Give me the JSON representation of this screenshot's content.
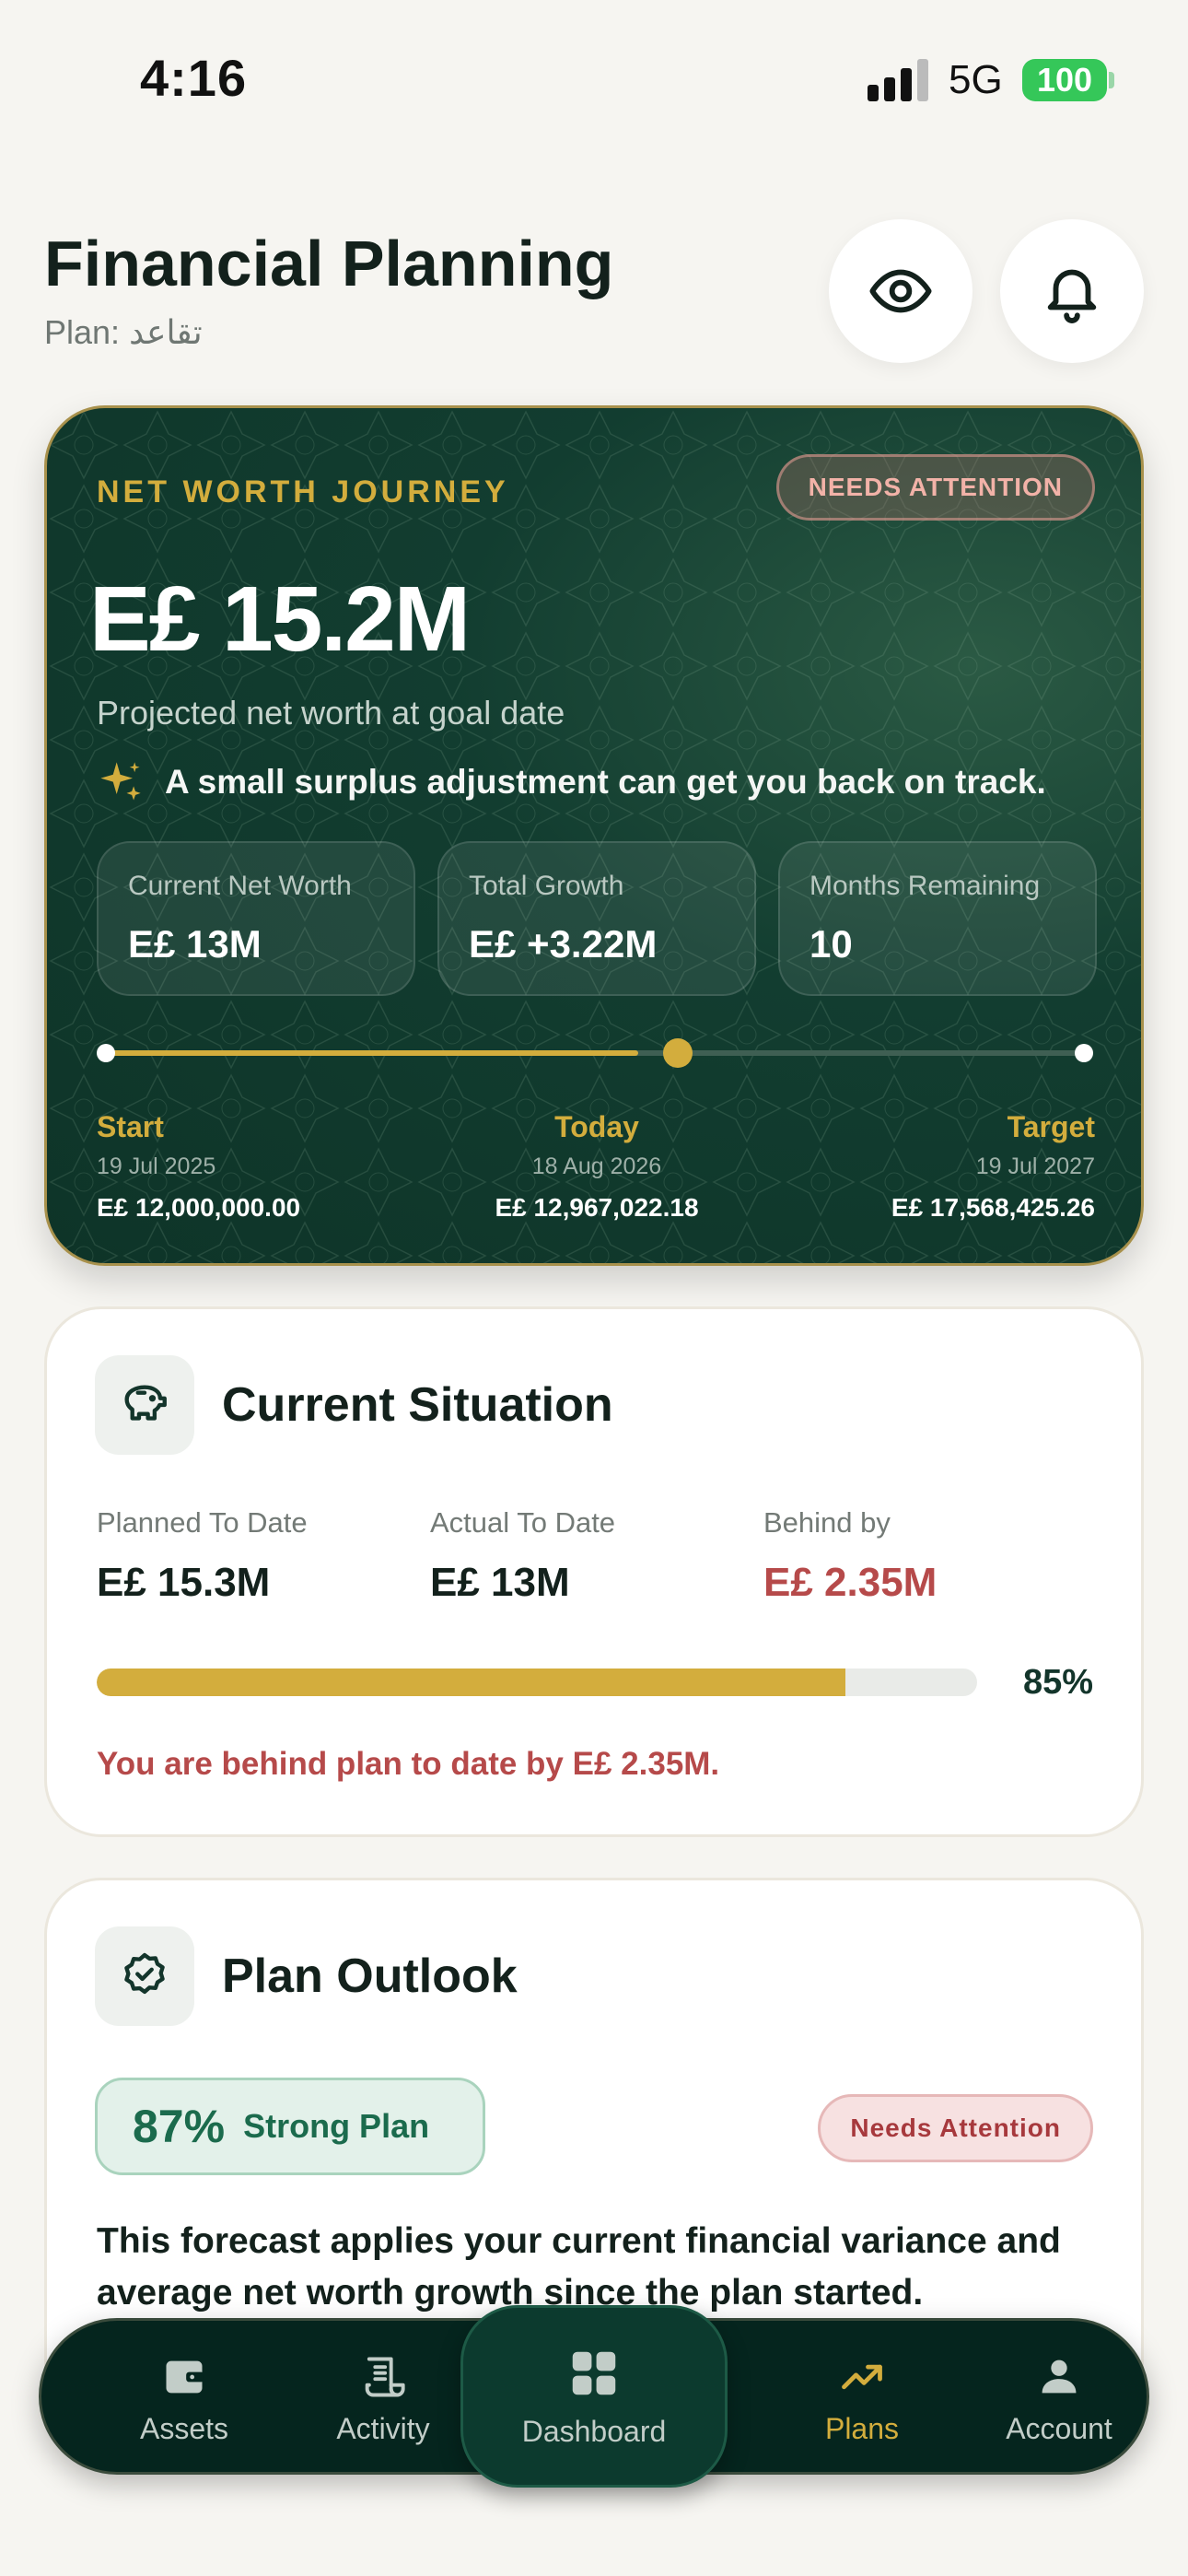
{
  "status_bar": {
    "time": "4:16",
    "network": "5G",
    "battery": "100"
  },
  "header": {
    "title": "Financial Planning",
    "plan_label": "Plan: تقاعد",
    "icons": [
      "eye-icon",
      "bell-icon"
    ]
  },
  "net_worth": {
    "label": "NET WORTH JOURNEY",
    "status_badge": "NEEDS ATTENTION",
    "value": "E£ 15.2M",
    "caption": "Projected net worth at goal date",
    "tip": "A small surplus adjustment can get you back on track.",
    "stats": [
      {
        "label": "Current Net Worth",
        "value": "E£ 13M"
      },
      {
        "label": "Total Growth",
        "value": "E£ +3.22M"
      },
      {
        "label": "Months Remaining",
        "value": "10"
      }
    ],
    "timeline_progress": 0.545,
    "timeline": {
      "start": {
        "label": "Start",
        "date": "19 Jul 2025",
        "amount": "E£ 12,000,000.00"
      },
      "today": {
        "label": "Today",
        "date": "18 Aug 2026",
        "amount": "E£ 12,967,022.18"
      },
      "target": {
        "label": "Target",
        "date": "19 Jul 2027",
        "amount": "E£ 17,568,425.26"
      }
    }
  },
  "current_situation": {
    "title": "Current Situation",
    "icon": "piggy-bank-icon",
    "planned": {
      "label": "Planned To Date",
      "value": "E£ 15.3M"
    },
    "actual": {
      "label": "Actual To Date",
      "value": "E£ 13M"
    },
    "behind": {
      "label": "Behind by",
      "value": "E£ 2.35M"
    },
    "progress": 0.85,
    "progress_label": "85%",
    "message": "You are behind plan to date by E£ 2.35M."
  },
  "plan_outlook": {
    "title": "Plan Outlook",
    "icon": "badge-check-icon",
    "score": "87%",
    "score_label": "Strong Plan",
    "status": "Needs Attention",
    "forecast": "This forecast applies your current financial variance and average net worth growth since the plan started."
  },
  "nav": {
    "items": [
      {
        "label": "Assets",
        "icon": "wallet-icon"
      },
      {
        "label": "Activity",
        "icon": "receipt-icon"
      },
      {
        "label": "Dashboard",
        "icon": "grid-icon"
      },
      {
        "label": "Plans",
        "icon": "trending-up-icon",
        "active": true
      },
      {
        "label": "Account",
        "icon": "user-icon"
      }
    ]
  },
  "colors": {
    "accent_gold": "#d3ad3d",
    "card_green": "#123d30",
    "alert_red": "#b64a4a",
    "success_green": "#1b6b4d",
    "nav_dark": "#05251e"
  }
}
